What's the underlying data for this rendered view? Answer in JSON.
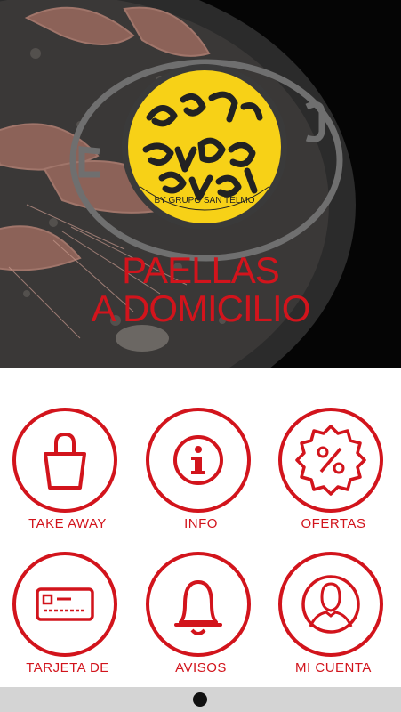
{
  "hero": {
    "brand_tagline": "BY GRUPO SAN TELMO",
    "title_line1": "PAELLAS",
    "title_line2": "A DOMICILIO"
  },
  "menu": [
    {
      "label": "TAKE AWAY",
      "icon": "shopping-bag-icon"
    },
    {
      "label": "INFO",
      "icon": "info-icon"
    },
    {
      "label": "OFERTAS",
      "icon": "percent-badge-icon"
    },
    {
      "label": "TARJETA DE",
      "icon": "card-icon"
    },
    {
      "label": "AVISOS",
      "icon": "bell-icon"
    },
    {
      "label": "MI CUENTA",
      "icon": "user-icon"
    }
  ],
  "colors": {
    "accent": "#d2141c",
    "logo_yellow": "#f7d117"
  }
}
